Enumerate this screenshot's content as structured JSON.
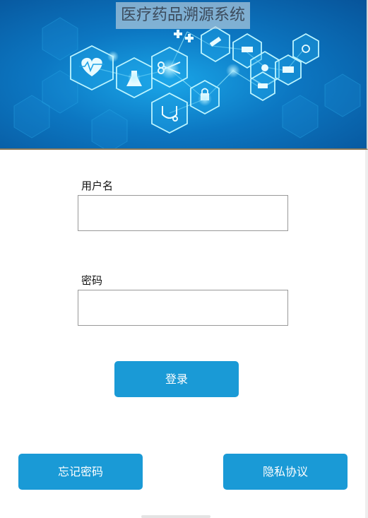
{
  "header": {
    "title": "医疗药品溯源系统",
    "banner_image": "medical-technology-hexagon-banner"
  },
  "login_form": {
    "username_label": "用户名",
    "username_value": "",
    "username_placeholder": "",
    "password_label": "密码",
    "password_value": "",
    "password_placeholder": "",
    "login_button_label": "登录"
  },
  "footer_actions": {
    "forgot_password_label": "忘记密码",
    "privacy_policy_label": "隐私协议"
  },
  "colors": {
    "primary_button": "#1a9ad6",
    "banner_blue": "#0c77c2",
    "input_border": "#999999"
  }
}
